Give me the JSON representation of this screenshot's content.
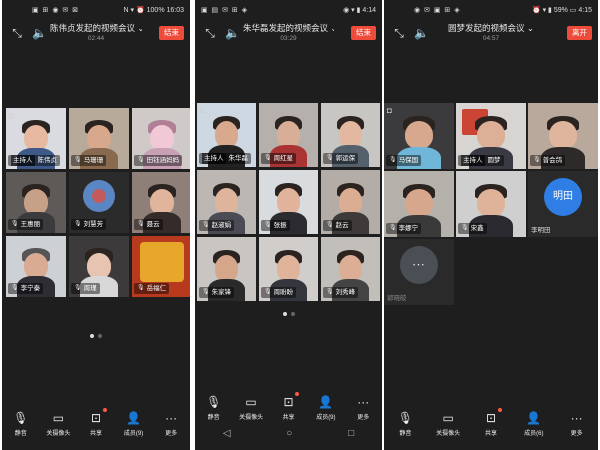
{
  "labels": {
    "host": "主持人"
  },
  "toolbar": {
    "mute": "静音",
    "camera_off": "关摄像头",
    "share": "共享",
    "more": "更多"
  },
  "phones": [
    {
      "status_left": "▣ ⊞ ◉ ✉ ⊠",
      "status_right": "N ▾ ⏰ 100% 16:03",
      "title": "陈伟贞发起的视频会议 ⌄",
      "time": "02:44",
      "end_label": "结束",
      "members_label": "成员(9)",
      "participants": [
        {
          "name": "陈伟贞",
          "host": true
        },
        {
          "name": "马珊珊",
          "host": false
        },
        {
          "name": "田钰涵妈妈",
          "host": false
        },
        {
          "name": "王惠丽",
          "host": false
        },
        {
          "name": "刘慧芳",
          "host": false
        },
        {
          "name": "聂云",
          "host": false
        },
        {
          "name": "李宁秦",
          "host": false
        },
        {
          "name": "周瑾",
          "host": false
        },
        {
          "name": "岳福仁",
          "host": false
        }
      ]
    },
    {
      "status_left": "▣ ▤ ✉ ⊞ ◈",
      "status_right": "◉ ▾ ▮ 4:14",
      "title": "朱华磊发起的视频会议 ⌄",
      "time": "03:29",
      "end_label": "结束",
      "members_label": "成员(9)",
      "participants": [
        {
          "name": "朱华磊",
          "host": true
        },
        {
          "name": "周红星",
          "host": false
        },
        {
          "name": "郭运保",
          "host": false
        },
        {
          "name": "赵淑娟",
          "host": false
        },
        {
          "name": "张振",
          "host": false
        },
        {
          "name": "赵云",
          "host": false
        },
        {
          "name": "朱家锋",
          "host": false
        },
        {
          "name": "周盼盼",
          "host": false
        },
        {
          "name": "刘秀峰",
          "host": false
        }
      ]
    },
    {
      "status_left": "◉ ✉ ▣ ⊞ ◈",
      "status_right": "⏰ ▾ ▮ 59% ▭ 4:15",
      "title": "圆梦发起的视频会议 ⌄",
      "time": "04:57",
      "end_label": "离开",
      "members_label": "成员(6)",
      "avatar_text": "明田",
      "loading_text": "∙∙∙",
      "participants": [
        {
          "name": "马保国",
          "host": false
        },
        {
          "name": "圆梦",
          "host": true
        },
        {
          "name": "普会鸽",
          "host": false
        },
        {
          "name": "李娜宁",
          "host": false
        },
        {
          "name": "宋鑫",
          "host": false
        },
        {
          "name": "李明田",
          "host": false
        },
        {
          "name": "郭晓皎",
          "host": false
        }
      ]
    }
  ]
}
